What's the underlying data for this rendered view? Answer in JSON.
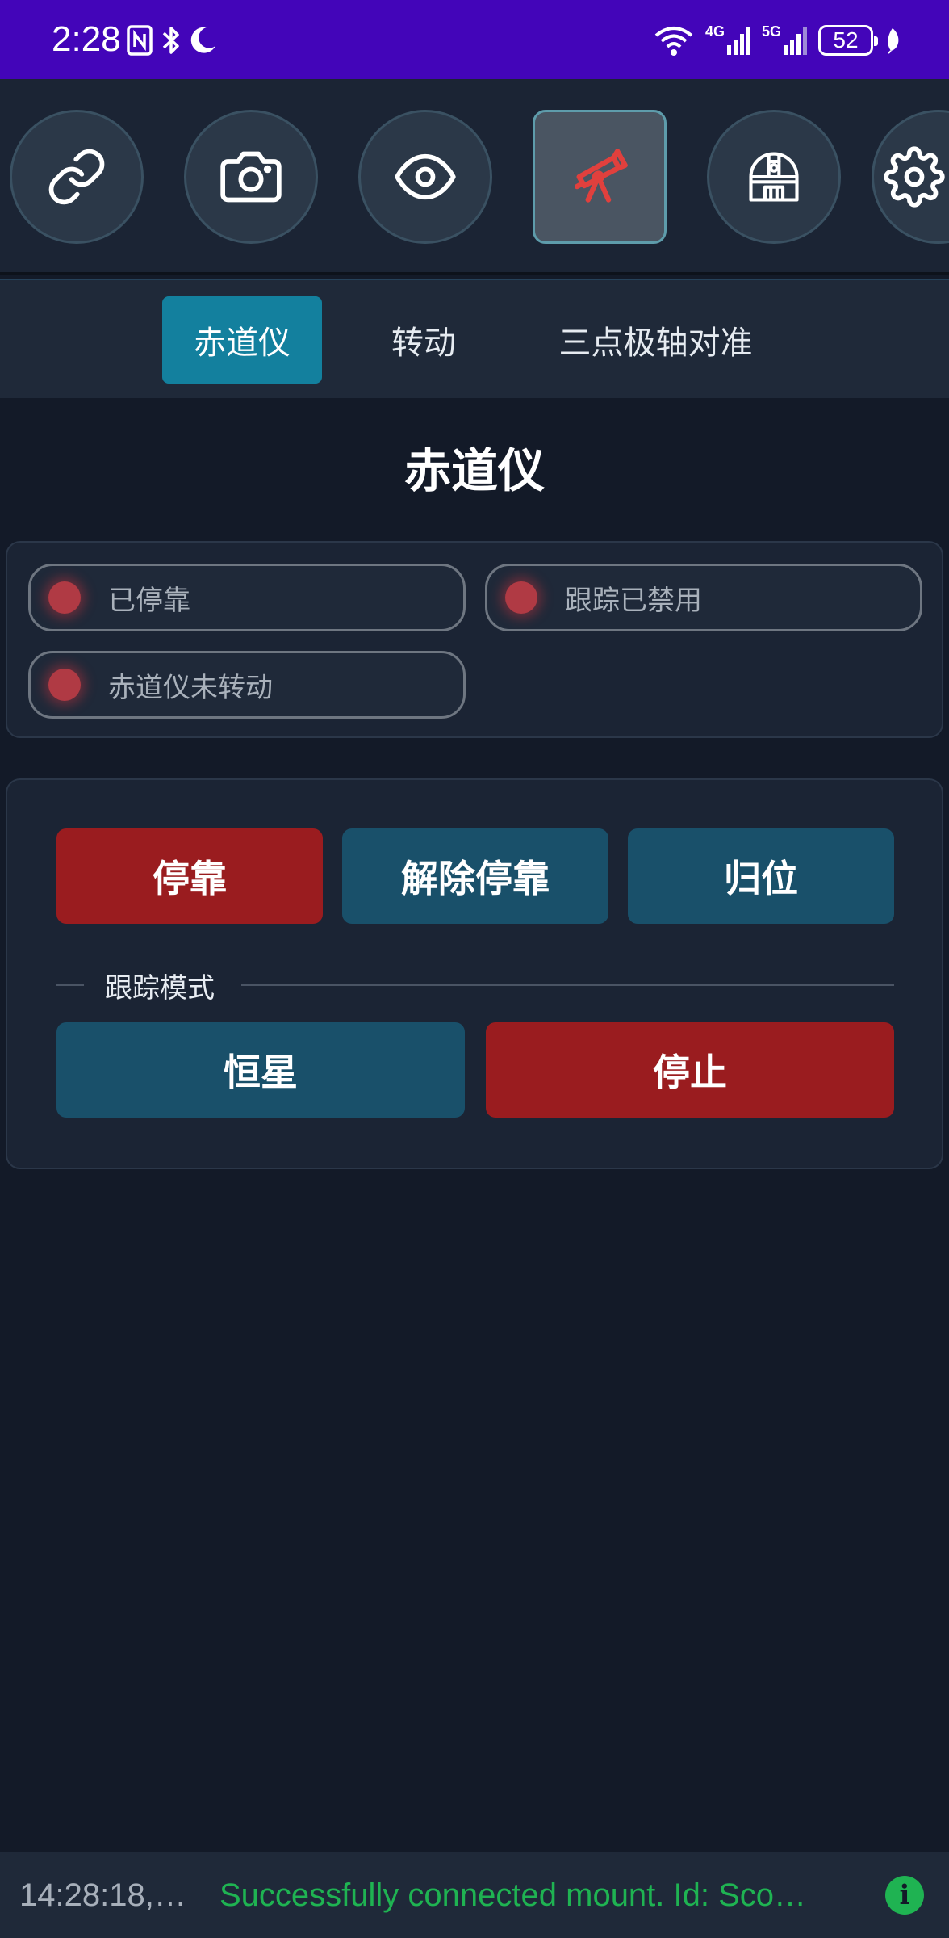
{
  "status_bar": {
    "time": "2:28",
    "network_4g": "4G",
    "network_5g": "5G",
    "battery": "52",
    "left_icons": [
      "nfc-icon",
      "bluetooth-icon",
      "moon-icon"
    ],
    "right_icons": [
      "wifi-icon",
      "signal-4g-icon",
      "signal-5g-icon",
      "battery-icon",
      "leaf-icon"
    ]
  },
  "top_nav": {
    "items": [
      {
        "icon": "link-icon",
        "active": false
      },
      {
        "icon": "camera-icon",
        "active": false
      },
      {
        "icon": "eye-icon",
        "active": false
      },
      {
        "icon": "telescope-icon",
        "active": true
      },
      {
        "icon": "observatory-dome-icon",
        "active": false
      },
      {
        "icon": "gear-icon",
        "active": false
      }
    ],
    "active_color": "#e0403d"
  },
  "tabs": [
    {
      "label": "赤道仪",
      "active": true
    },
    {
      "label": "转动",
      "active": false
    },
    {
      "label": "三点极轴对准",
      "active": false
    }
  ],
  "page": {
    "title": "赤道仪"
  },
  "status_pills": [
    {
      "label": "已停靠"
    },
    {
      "label": "跟踪已禁用"
    },
    {
      "label": "赤道仪未转动"
    }
  ],
  "controls": {
    "park_label": "停靠",
    "unpark_label": "解除停靠",
    "home_label": "归位",
    "tracking_mode_label": "跟踪模式",
    "sidereal_label": "恒星",
    "stop_label": "停止"
  },
  "log": {
    "time": "14:28:18,…",
    "message": "Successfully connected mount. Id: Sco…"
  },
  "colors": {
    "status_bar": "#4305b9",
    "background": "#131a28",
    "panel": "#1b2434",
    "accent_teal": "#13809e",
    "button_teal": "#19506a",
    "button_red": "#9a1c1f",
    "success_green": "#1fb352"
  }
}
